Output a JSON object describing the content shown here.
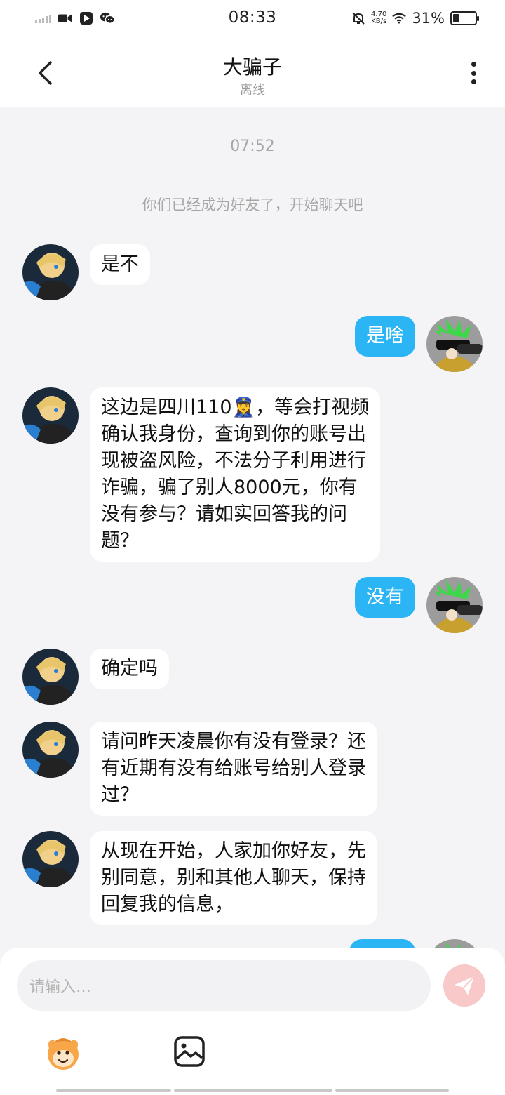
{
  "status_bar": {
    "time": "08:33",
    "net_speed_value": "4.70",
    "net_speed_unit": "KB/s",
    "battery_percent": "31%",
    "battery_level": 0.31,
    "icons": [
      "signal-icon",
      "video-icon",
      "play-icon",
      "wechat-icon",
      "mute-icon",
      "wifi-icon",
      "battery-icon"
    ]
  },
  "header": {
    "title": "大骗子",
    "subtitle": "离线",
    "back_icon": "chevron-left-icon",
    "more_icon": "more-vertical-icon"
  },
  "chat": {
    "timestamp": "07:52",
    "system_message": "你们已经成为好友了，开始聊天吧",
    "messages": [
      {
        "side": "in",
        "text": "是不"
      },
      {
        "side": "out",
        "text": "是啥"
      },
      {
        "side": "in",
        "lines": [
          "这边是四川110👮‍♀️，等会打视频",
          "确认我身份，查询到你的账号出",
          "现被盗风险，不法分子利用进行",
          "诈骗，骗了别人8000元，你有",
          "没有参与？请如实回答我的问",
          "题？"
        ]
      },
      {
        "side": "out",
        "text": "没有"
      },
      {
        "side": "in",
        "text": "确定吗"
      },
      {
        "side": "in",
        "lines": [
          "请问昨天凌晨你有没有登录？还",
          "有近期有没有给账号给别人登录",
          "过？"
        ]
      },
      {
        "side": "in",
        "lines": [
          "从现在开始，人家加你好友，先",
          "别同意，别和其他人聊天，保持",
          "回复我的信息，"
        ]
      }
    ]
  },
  "composer": {
    "placeholder": "请输入…",
    "send_icon": "send-icon",
    "emoji_icon": "emoji-face-icon",
    "image_icon": "image-icon"
  },
  "colors": {
    "outgoing_bubble": "#2bb5f4",
    "send_button": "#f9c8c8",
    "background": "#f4f4f6"
  }
}
